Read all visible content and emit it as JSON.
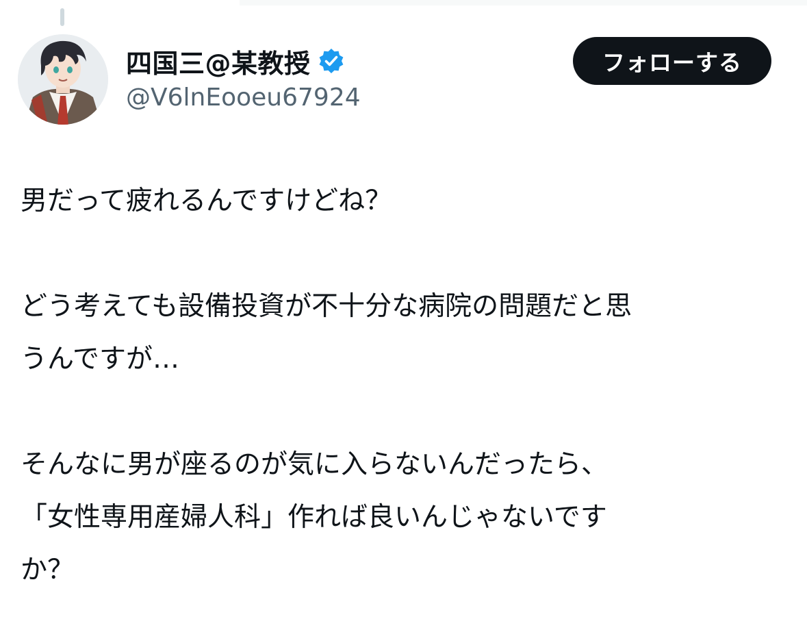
{
  "tweet": {
    "author": {
      "display_name": "四国三@某教授",
      "handle": "@V6lnEooeu67924",
      "verified": true,
      "avatar_icon": "avatar-illustration-icon"
    },
    "follow_button_label": "フォローする",
    "body_paragraphs": [
      "男だって疲れるんですけどね？",
      "どう考えても設備投資が不十分な病院の問題だと思\nうんですが…",
      "そんなに男が座るのが気に入らないんだったら、\n「女性専用産婦人科」作れば良いんじゃないです\nか？"
    ]
  },
  "colors": {
    "verified_badge": "#1d9bf0",
    "button_bg": "#0f1419",
    "secondary_text": "#536471"
  }
}
